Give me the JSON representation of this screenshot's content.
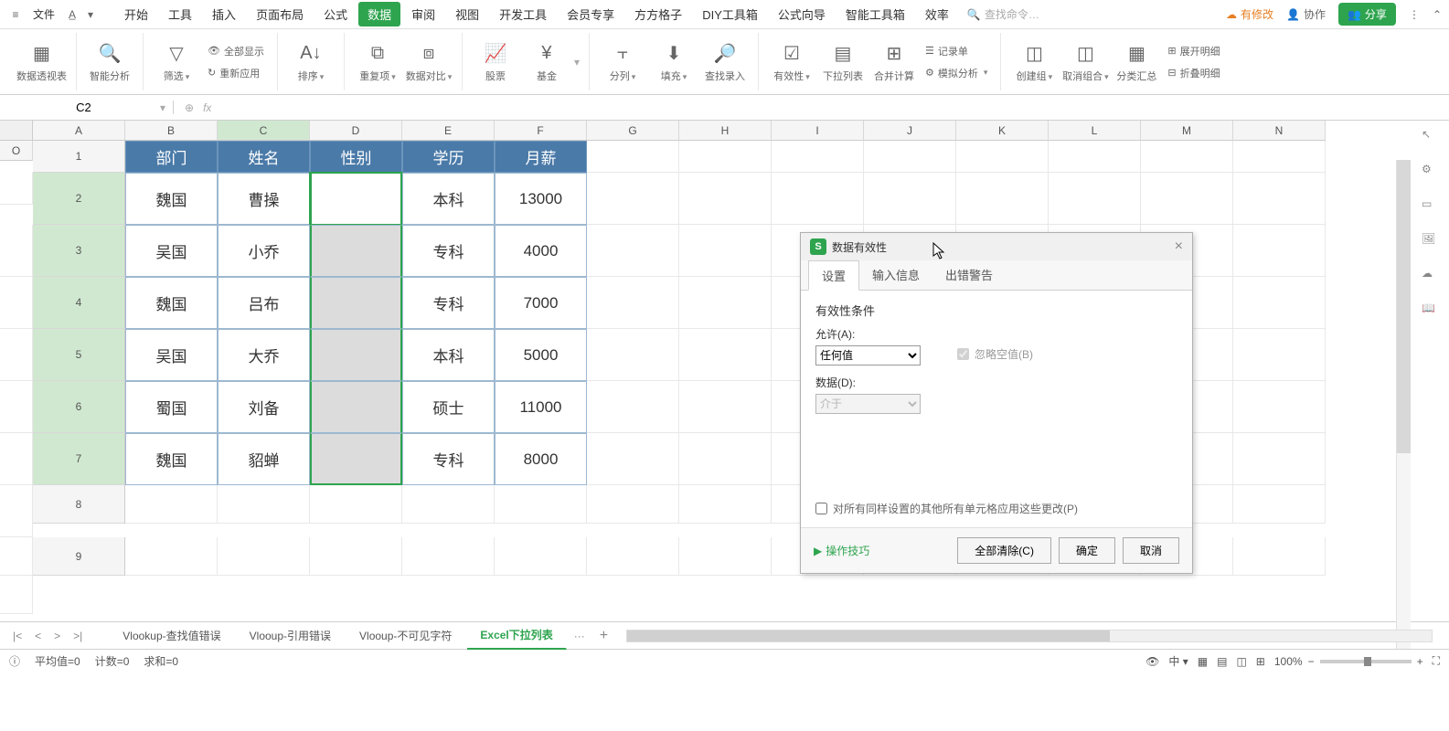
{
  "menubar": {
    "file": "文件",
    "tabs": [
      "开始",
      "工具",
      "插入",
      "页面布局",
      "公式",
      "数据",
      "审阅",
      "视图",
      "开发工具",
      "会员专享",
      "方方格子",
      "DIY工具箱",
      "公式向导",
      "智能工具箱",
      "效率"
    ],
    "active_tab": "数据",
    "search_placeholder": "查找命令…",
    "changes": "有修改",
    "collab": "协作",
    "share": "分享"
  },
  "ribbon": {
    "pivot": "数据透视表",
    "smart_analysis": "智能分析",
    "filter": "筛选",
    "show_all": "全部显示",
    "reapply": "重新应用",
    "sort": "排序",
    "dedupe": "重复项",
    "compare": "数据对比",
    "stock": "股票",
    "fund": "基金",
    "split": "分列",
    "fill": "填充",
    "find_input": "查找录入",
    "validation": "有效性",
    "dropdown": "下拉列表",
    "consolidate": "合并计算",
    "record": "记录单",
    "sim": "模拟分析",
    "group_create": "创建组",
    "ungroup": "取消组合",
    "subtotal": "分类汇总",
    "expand": "展开明细",
    "collapse": "折叠明细"
  },
  "formula_bar": {
    "cell_ref": "C2",
    "fx": "fx"
  },
  "columns": [
    "A",
    "B",
    "C",
    "D",
    "E",
    "F",
    "G",
    "H",
    "I",
    "J",
    "K",
    "L",
    "M",
    "N",
    "O"
  ],
  "table": {
    "headers": [
      "部门",
      "姓名",
      "性别",
      "学历",
      "月薪"
    ],
    "rows": [
      {
        "dept": "魏国",
        "name": "曹操",
        "gender": "",
        "edu": "本科",
        "salary": "13000"
      },
      {
        "dept": "吴国",
        "name": "小乔",
        "gender": "",
        "edu": "专科",
        "salary": "4000"
      },
      {
        "dept": "魏国",
        "name": "吕布",
        "gender": "",
        "edu": "专科",
        "salary": "7000"
      },
      {
        "dept": "吴国",
        "name": "大乔",
        "gender": "",
        "edu": "本科",
        "salary": "5000"
      },
      {
        "dept": "蜀国",
        "name": "刘备",
        "gender": "",
        "edu": "硕士",
        "salary": "11000"
      },
      {
        "dept": "魏国",
        "name": "貂蝉",
        "gender": "",
        "edu": "专科",
        "salary": "8000"
      }
    ]
  },
  "dialog": {
    "title": "数据有效性",
    "tabs": [
      "设置",
      "输入信息",
      "出错警告"
    ],
    "active_tab": "设置",
    "section": "有效性条件",
    "allow_label": "允许(A):",
    "allow_value": "任何值",
    "ignore_blank": "忽略空值(B)",
    "data_label": "数据(D):",
    "data_value": "介于",
    "apply_all": "对所有同样设置的其他所有单元格应用这些更改(P)",
    "tips": "操作技巧",
    "clear": "全部清除(C)",
    "ok": "确定",
    "cancel": "取消"
  },
  "sheets": {
    "items": [
      "Vlookup-查找值错误",
      "Vlooup-引用错误",
      "Vlooup-不可见字符",
      "Excel下拉列表"
    ],
    "active": "Excel下拉列表",
    "more": "···"
  },
  "status": {
    "avg": "平均值=0",
    "count": "计数=0",
    "sum": "求和=0",
    "zoom": "100%"
  }
}
